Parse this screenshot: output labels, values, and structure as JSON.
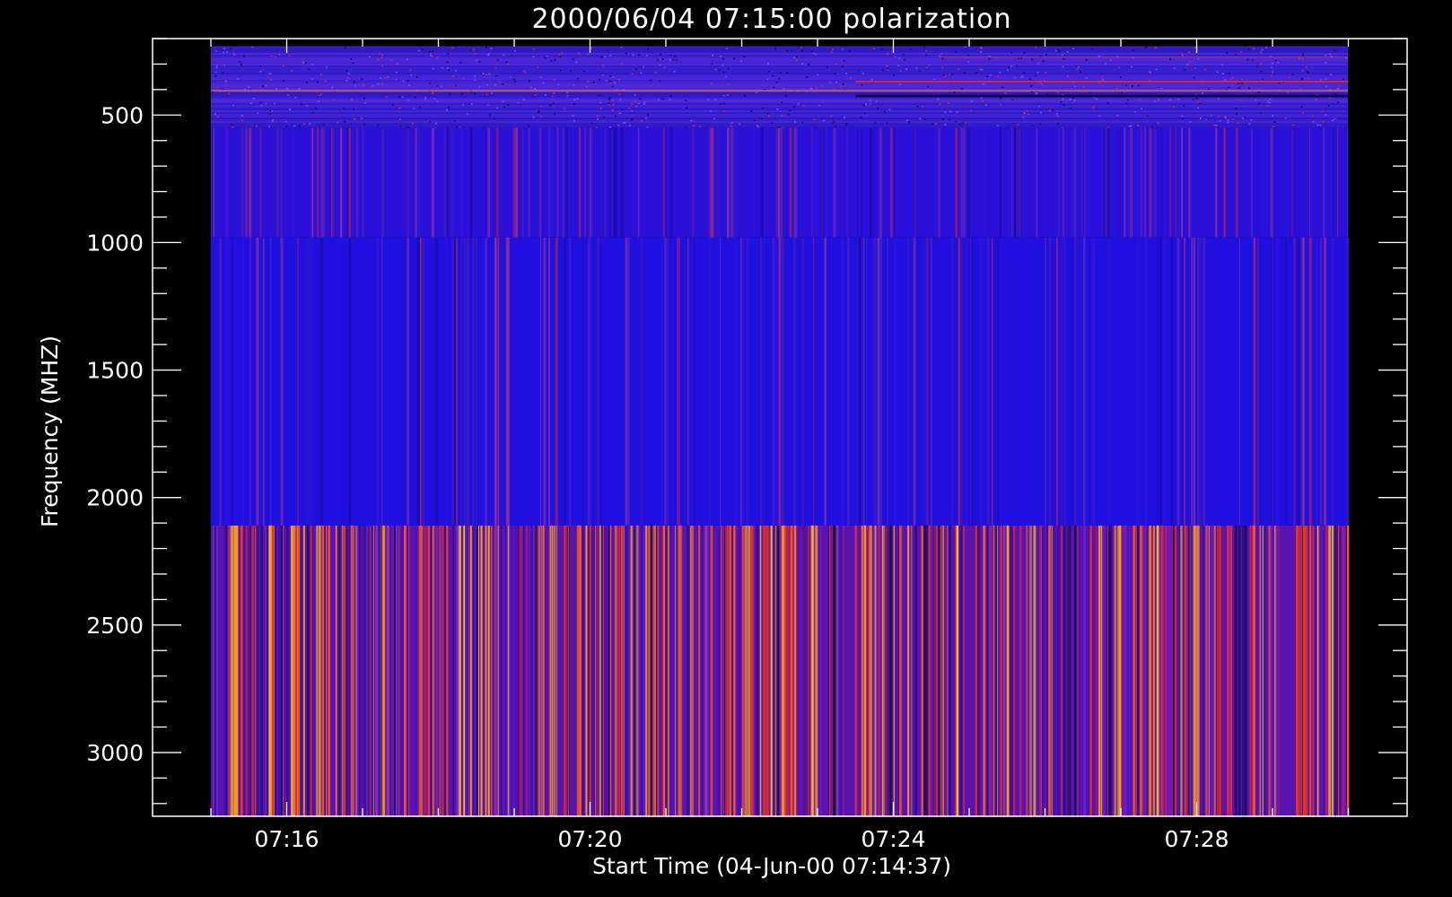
{
  "chart_data": {
    "type": "heatmap",
    "title": "2000/06/04 07:15:00 polarization",
    "xlabel": "Start Time (04-Jun-00 07:14:37)",
    "ylabel": "Frequency (MHZ)",
    "y_axis_inverted": true,
    "ylim": [
      200,
      3250
    ],
    "x_range_minutes": [
      0.4,
      15.4
    ],
    "x_ticks": [
      {
        "label": "07:16",
        "minute": 1
      },
      {
        "label": "07:20",
        "minute": 5
      },
      {
        "label": "07:24",
        "minute": 9
      },
      {
        "label": "07:28",
        "minute": 13
      }
    ],
    "y_ticks": [
      {
        "label": "500",
        "value": 500
      },
      {
        "label": "1000",
        "value": 1000
      },
      {
        "label": "1500",
        "value": 1500
      },
      {
        "label": "2000",
        "value": 2000
      },
      {
        "label": "2500",
        "value": 2500
      },
      {
        "label": "3000",
        "value": 3000
      }
    ],
    "bands": [
      {
        "freq_range": [
          230,
          550
        ],
        "dominant_color": "#3a1fd6",
        "texture": "speckled"
      },
      {
        "freq_range": [
          550,
          980
        ],
        "dominant_color": "#2a10d8",
        "texture": "vertical-stripes"
      },
      {
        "freq_range": [
          980,
          2110
        ],
        "dominant_color": "#2010e0",
        "texture": "vertical-stripes"
      },
      {
        "freq_range": [
          2110,
          3250
        ],
        "dominant_color": "#5a12b0",
        "texture": "vertical-stripes-bright"
      }
    ],
    "grid": false,
    "background_color": "#000000",
    "foreground_color": "#ffffff"
  }
}
